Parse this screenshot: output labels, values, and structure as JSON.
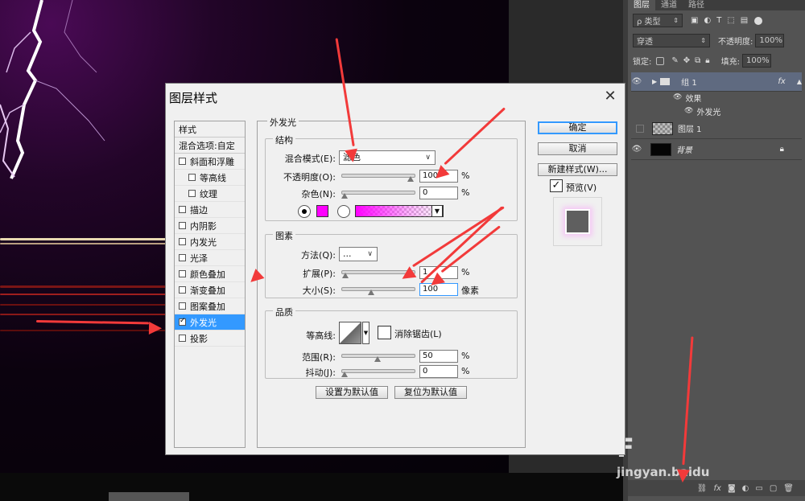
{
  "layers_panel": {
    "tabs": [
      "图层",
      "通道",
      "路径"
    ],
    "filter_kind": "ρ 类型",
    "blend_mode": "穿透",
    "opacity_label": "不透明度:",
    "opacity_value": "100%",
    "lock_label": "锁定:",
    "fill_label": "填充:",
    "fill_value": "100%",
    "layers": [
      {
        "name": "组 1",
        "fx": "fx",
        "visible": true
      },
      {
        "name": "效果"
      },
      {
        "name": "外发光"
      },
      {
        "name": "图层 1",
        "visible": false
      },
      {
        "name": "背景",
        "visible": true,
        "locked": true
      }
    ],
    "bottom_icons": [
      "link-icon",
      "fx-icon",
      "mask-icon",
      "adjustment-icon",
      "folder-icon",
      "new-layer-icon",
      "trash-icon"
    ],
    "bottom_fx": "fx"
  },
  "watermark": {
    "line1": "F",
    "line2": "jingyan.baidu"
  },
  "dialog": {
    "title": "图层样式",
    "style_list": [
      {
        "label": "样式",
        "header": true
      },
      {
        "label": "混合选项:自定",
        "header": true
      },
      {
        "label": "斜面和浮雕",
        "checked": false
      },
      {
        "label": "等高线",
        "checked": false,
        "indent": true
      },
      {
        "label": "纹理",
        "checked": false,
        "indent": true
      },
      {
        "label": "描边",
        "checked": false
      },
      {
        "label": "内阴影",
        "checked": false
      },
      {
        "label": "内发光",
        "checked": false
      },
      {
        "label": "光泽",
        "checked": false
      },
      {
        "label": "颜色叠加",
        "checked": false
      },
      {
        "label": "渐变叠加",
        "checked": false
      },
      {
        "label": "图案叠加",
        "checked": false
      },
      {
        "label": "外发光",
        "checked": true,
        "selected": true
      },
      {
        "label": "投影",
        "checked": false
      }
    ],
    "outer_glow": {
      "section_title": "外发光",
      "structure": {
        "title": "结构",
        "blend_mode_label": "混合模式(E):",
        "blend_mode_value": "滤色",
        "opacity_label": "不透明度(O):",
        "opacity_value": "100",
        "opacity_fraction": 1.0,
        "noise_label": "杂色(N):",
        "noise_value": "0",
        "noise_fraction": 0.0,
        "color": "#ff00ff",
        "unit": "%"
      },
      "elements": {
        "title": "图素",
        "technique_label": "方法(Q):",
        "technique_value": "...",
        "spread_label": "扩展(P):",
        "spread_value": "1",
        "spread_fraction": 0.01,
        "size_label": "大小(S):",
        "size_value": "100",
        "size_fraction": 0.4,
        "size_unit": "像素",
        "unit": "%"
      },
      "quality": {
        "title": "品质",
        "contour_label": "等高线:",
        "anti_alias_label": "消除锯齿(L)",
        "range_label": "范围(R):",
        "range_value": "50",
        "range_fraction": 0.5,
        "jitter_label": "抖动(J):",
        "jitter_value": "0",
        "jitter_fraction": 0.0,
        "unit": "%"
      },
      "set_default": "设置为默认值",
      "reset_default": "复位为默认值"
    },
    "buttons": {
      "ok": "确定",
      "cancel": "取消",
      "new_style": "新建样式(W)...",
      "preview": "预览(V)",
      "preview_checked": true
    }
  },
  "colors": {
    "accent": "#3399ff",
    "glow": "#ff00ff",
    "arrow": "#f23a3a"
  }
}
